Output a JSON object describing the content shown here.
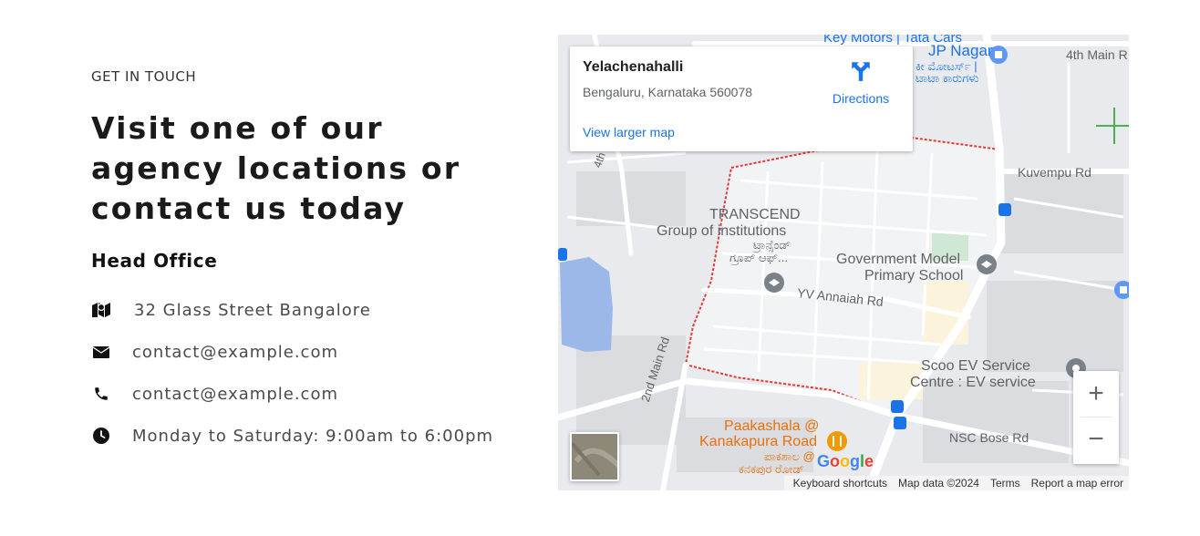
{
  "contact": {
    "eyebrow": "GET IN TOUCH",
    "heading": "Visit one of our agency locations or contact us today",
    "office_title": "Head Office",
    "items": [
      {
        "icon": "map-icon",
        "text": "32 Glass Street Bangalore"
      },
      {
        "icon": "envelope-icon",
        "text": "contact@example.com"
      },
      {
        "icon": "phone-icon",
        "text": "contact@example.com"
      },
      {
        "icon": "clock-icon",
        "text": "Monday to Saturday: 9:00am to 6:00pm"
      }
    ]
  },
  "map": {
    "card": {
      "title": "Yelachenahalli",
      "address": "Bengaluru, Karnataka 560078",
      "directions": "Directions",
      "larger_map": "View larger map"
    },
    "labels": {
      "key_motors": "Key Motors | Tata Cars",
      "jp_nagar": "JP Nagar",
      "key_motors_kn1": "ಕೀ ಮೋಟರ್ಸ್ |",
      "key_motors_kn2": "ಟಾಟಾ ಕಾರುಗಳು",
      "fourth_main": "4th Main R",
      "kuvempu": "Kuvempu Rd",
      "transcend1": "TRANSCEND",
      "transcend2": "Group of institutions",
      "transcend_kn1": "ಟ್ರಾನ್ಸೆಂಡ್",
      "transcend_kn2": "ಗ್ರೂಪ್ ಆಫ್...",
      "govt1": "Government Model",
      "govt2": "Primary School",
      "yv_annaiah": "YV Annaiah Rd",
      "scoo1": "Scoo EV Service",
      "scoo2": "Centre : EV service",
      "second_main": "2nd Main Rd",
      "paakashala1": "Paakashala @",
      "paakashala2": "Kanakapura Road",
      "paakashala_kn1": "ಪಾಕಶಾಲ @",
      "paakashala_kn2": "ಕನಕಪುರ ರೋಡ್",
      "nsc_bose": "NSC Bose Rd",
      "fourth_left": "4th"
    },
    "google_logo": "Google",
    "zoom_in": "+",
    "zoom_out": "−",
    "attribution": {
      "shortcuts": "Keyboard shortcuts",
      "data": "Map data ©2024",
      "terms": "Terms",
      "report": "Report a map error"
    }
  }
}
